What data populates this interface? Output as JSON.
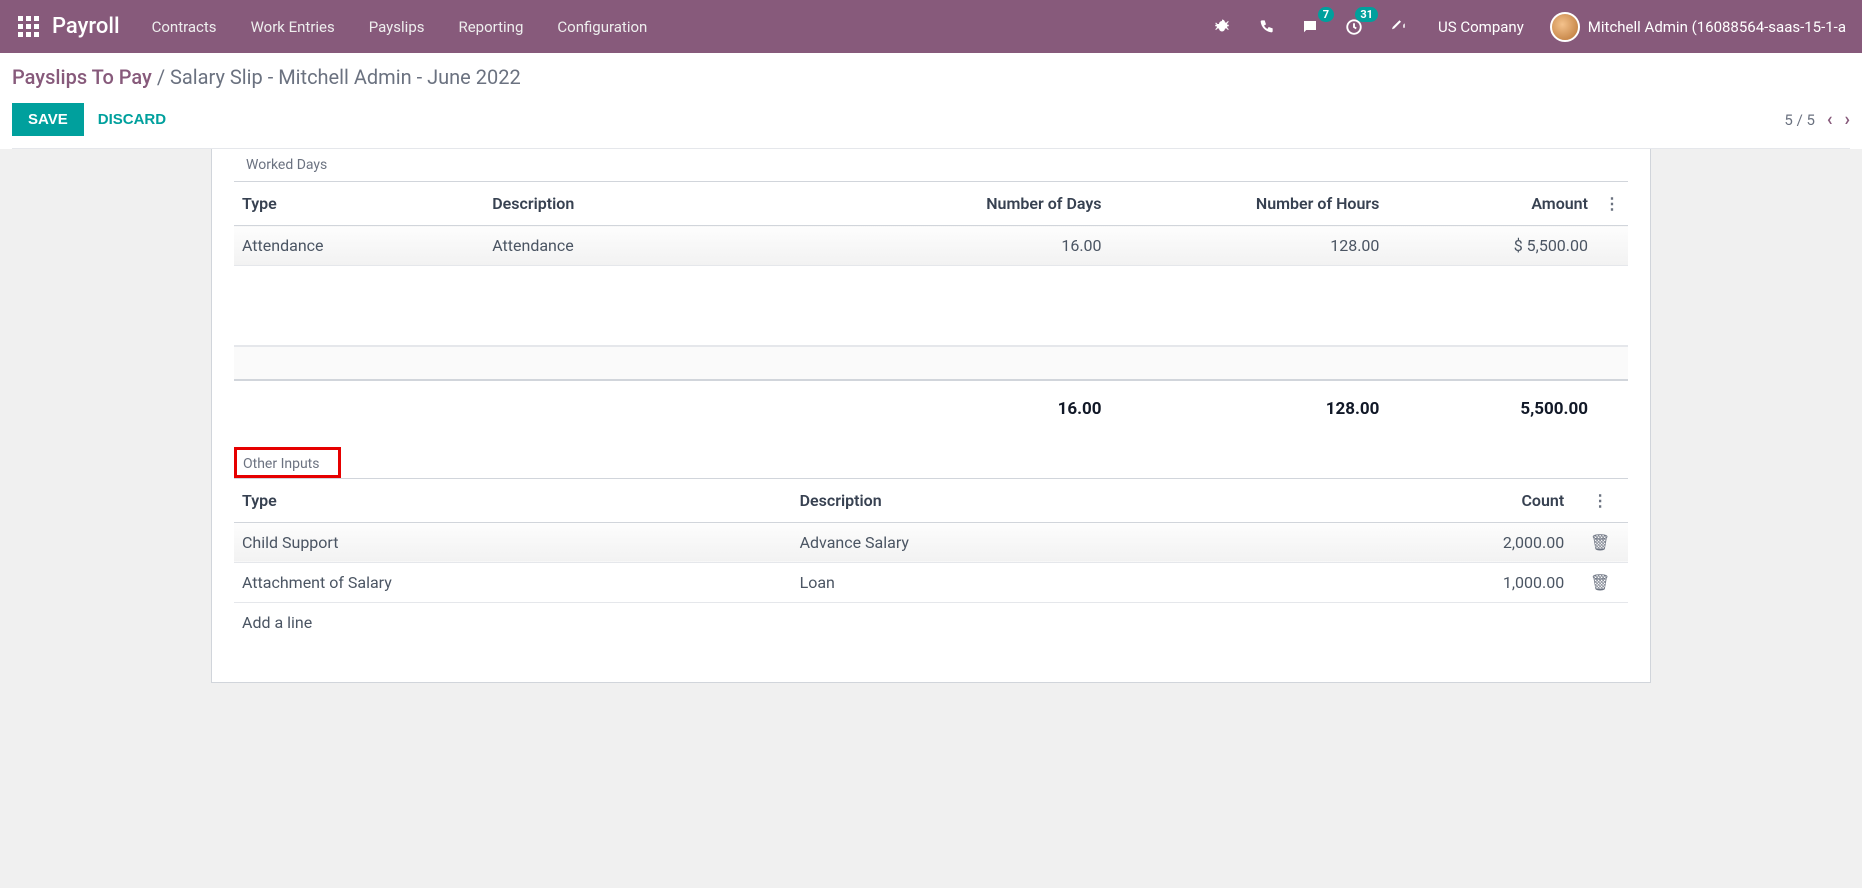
{
  "topbar": {
    "brand": "Payroll",
    "nav": [
      "Contracts",
      "Work Entries",
      "Payslips",
      "Reporting",
      "Configuration"
    ],
    "messages_badge": "7",
    "activities_badge": "31",
    "company": "US Company",
    "user": "Mitchell Admin (16088564-saas-15-1-a"
  },
  "breadcrumb": {
    "parent": "Payslips To Pay",
    "separator": " / ",
    "current": "Salary Slip - Mitchell Admin - June 2022"
  },
  "actions": {
    "save": "SAVE",
    "discard": "DISCARD"
  },
  "pager": {
    "text": "5 / 5"
  },
  "worked_days": {
    "title": "Worked Days",
    "headers": {
      "type": "Type",
      "description": "Description",
      "days": "Number of Days",
      "hours": "Number of Hours",
      "amount": "Amount"
    },
    "rows": [
      {
        "type": "Attendance",
        "description": "Attendance",
        "days": "16.00",
        "hours": "128.00",
        "amount": "$ 5,500.00"
      }
    ],
    "totals": {
      "days": "16.00",
      "hours": "128.00",
      "amount": "5,500.00"
    }
  },
  "other_inputs": {
    "title": "Other Inputs",
    "headers": {
      "type": "Type",
      "description": "Description",
      "count": "Count"
    },
    "rows": [
      {
        "type": "Child Support",
        "description": "Advance Salary",
        "count": "2,000.00"
      },
      {
        "type": "Attachment of Salary",
        "description": "Loan",
        "count": "1,000.00"
      }
    ],
    "add_line": "Add a line"
  }
}
